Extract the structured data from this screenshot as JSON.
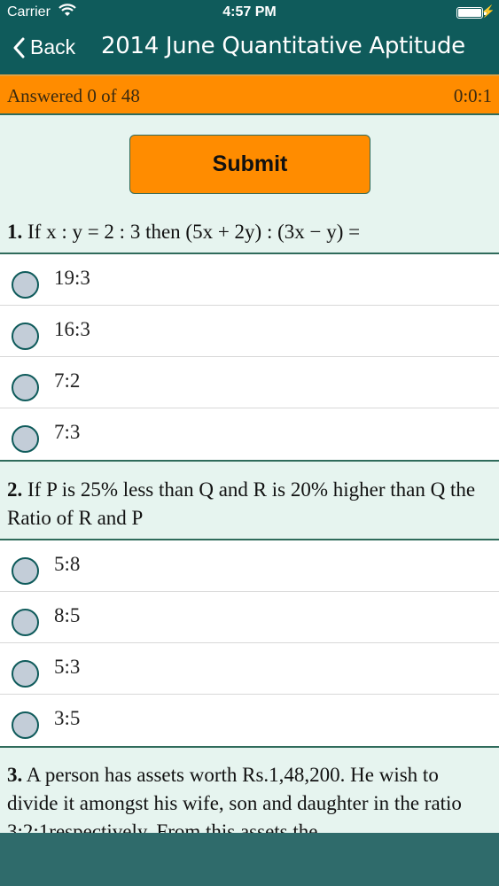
{
  "status_bar": {
    "carrier": "Carrier",
    "time": "4:57 PM"
  },
  "nav": {
    "back_label": "Back",
    "title": "2014 June Quantitative Aptitude"
  },
  "progress": {
    "answered": "Answered 0 of 48",
    "timer": "0:0:1"
  },
  "submit_label": "Submit",
  "questions": [
    {
      "number": "1.",
      "text": "If x : y = 2 : 3 then (5x + 2y) : (3x − y) =",
      "options": [
        "19:3",
        "16:3",
        "7:2",
        "7:3"
      ]
    },
    {
      "number": "2.",
      "text": "If P is 25% less than Q and R is 20% higher than Q the Ratio of R and P",
      "options": [
        "5:8",
        "8:5",
        "5:3",
        "3:5"
      ]
    },
    {
      "number": "3.",
      "text": "A person has assets worth Rs.1,48,200. He wish to divide it amongst his wife, son and daughter in the ratio 3:2:1respectively. From this assets the"
    }
  ]
}
